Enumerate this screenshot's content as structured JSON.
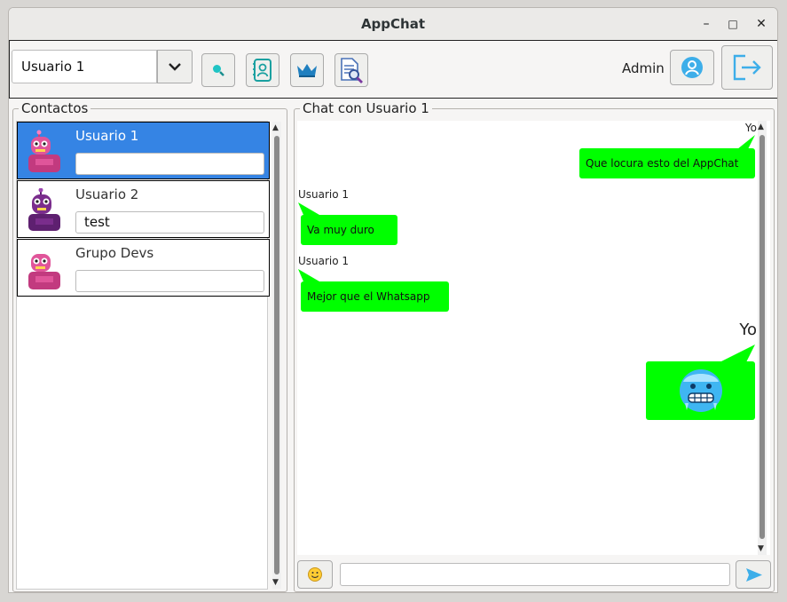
{
  "window": {
    "title": "AppChat",
    "minimize": "–",
    "maximize": "□",
    "close": "✕"
  },
  "toolbar": {
    "selected_user": "Usuario 1",
    "admin_label": "Admin",
    "icons": [
      "chevron-down-icon",
      "search-icon",
      "contacts-book-icon",
      "crown-icon",
      "document-search-icon",
      "user-profile-icon",
      "logout-icon"
    ]
  },
  "contacts": {
    "legend": "Contactos",
    "items": [
      {
        "name": "Usuario 1",
        "last_message": "",
        "selected": true,
        "avatar_color": "#e0559a"
      },
      {
        "name": "Usuario 2",
        "last_message": "test",
        "selected": false,
        "avatar_color": "#7a2d8c"
      },
      {
        "name": "Grupo Devs",
        "last_message": "",
        "selected": false,
        "avatar_color": "#e0559a"
      }
    ]
  },
  "chat": {
    "legend": "Chat con Usuario 1",
    "messages": [
      {
        "sender": "Yo",
        "text": "Que locura esto del AppChat",
        "own": true
      },
      {
        "sender": "Usuario 1",
        "text": "Va muy duro",
        "own": false
      },
      {
        "sender": "Usuario 1",
        "text": "Mejor que el Whatsapp",
        "own": false
      },
      {
        "sender": "Yo",
        "text": "",
        "own": true,
        "emoji": "cold-face-emoji"
      }
    ],
    "bubble_color": "#00ff00",
    "input_placeholder": ""
  },
  "colors": {
    "selection": "#3584e4",
    "accent": "#3daee9"
  }
}
